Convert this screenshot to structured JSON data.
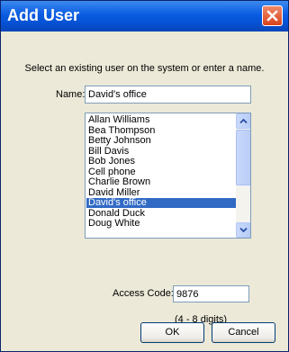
{
  "window": {
    "title": "Add User"
  },
  "instruction": "Select an existing user on the system or enter a name.",
  "name_field": {
    "label": "Name:",
    "value": "David's office"
  },
  "user_list": {
    "items": [
      "Allan Williams",
      "Bea Thompson",
      "Betty Johnson",
      "Bill Davis",
      "Bob Jones",
      "Cell phone",
      "Charlie Brown",
      "David Miller",
      "David's office",
      "Donald Duck",
      "Doug White"
    ],
    "selected": "David's office"
  },
  "access_code": {
    "label": "Access Code:",
    "value": "9876",
    "hint": "(4 - 8 digits)"
  },
  "buttons": {
    "ok": "OK",
    "cancel": "Cancel"
  },
  "icons": {
    "close": "close-icon",
    "scroll_up": "chevron-up-icon",
    "scroll_down": "chevron-down-icon"
  },
  "colors": {
    "titlebar": "#0653d6",
    "selection": "#316ac5",
    "close_button": "#d9431a",
    "dialog_bg": "#ece9d8"
  }
}
